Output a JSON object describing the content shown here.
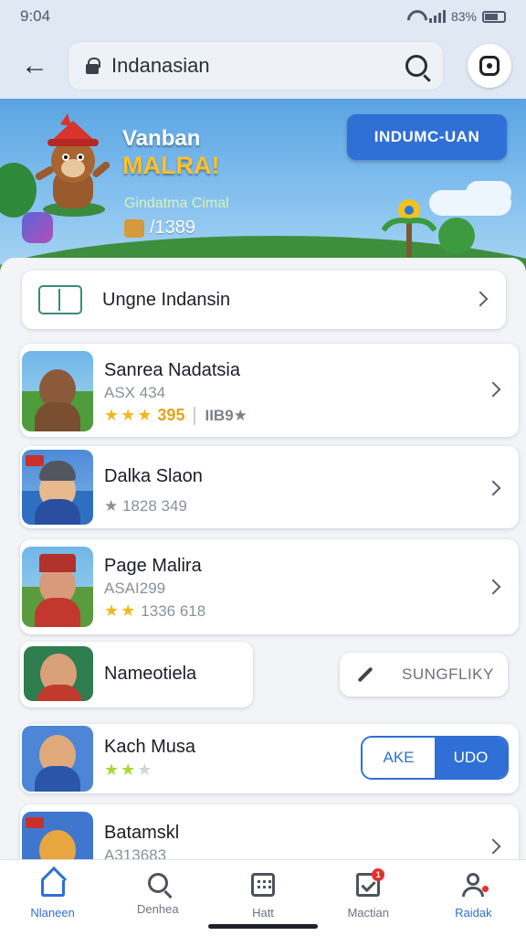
{
  "status_bar": {
    "time": "9:04",
    "battery": "83%"
  },
  "header": {
    "search_query": "Indanasian"
  },
  "banner": {
    "title_line1": "Vanban",
    "title_line2": "MALRA!",
    "subtitle": "Gindatma Cimal",
    "count": "/1389",
    "button_label": "INDUMC-UAN"
  },
  "top_card": {
    "label": "Ungne Indansin"
  },
  "list": [
    {
      "title": "Sanrea Nadatsia",
      "sub": "ASX 434",
      "rating": "395",
      "rank": "IIB9★",
      "stars": 3
    },
    {
      "title": "Dalka Slaon",
      "meta": "★ 1828 349"
    },
    {
      "title": "Page Malira",
      "sub": "ASAI299",
      "meta": "1336 618",
      "stars": 2
    },
    {
      "title": "Nameotiela"
    },
    {
      "title": "Kach Musa",
      "stars_filled": 2,
      "stars_empty": 1
    },
    {
      "title": "Batamskl",
      "sub": "A313683"
    }
  ],
  "suggest_button": {
    "label": "SUNGFLIKY"
  },
  "segment": {
    "left": "AKE",
    "right": "UDO"
  },
  "nav": [
    {
      "label": "Nlaneen",
      "icon": "home-icon"
    },
    {
      "label": "Denhea",
      "icon": "search-icon"
    },
    {
      "label": "Hatt",
      "icon": "grid-icon"
    },
    {
      "label": "Mactian",
      "icon": "check-icon",
      "badge": "1"
    },
    {
      "label": "Raidak",
      "icon": "user-icon"
    }
  ],
  "colors": {
    "accent": "#2f6fd6",
    "star": "#f3b81b",
    "banner_sky": "#5aa4e2"
  }
}
